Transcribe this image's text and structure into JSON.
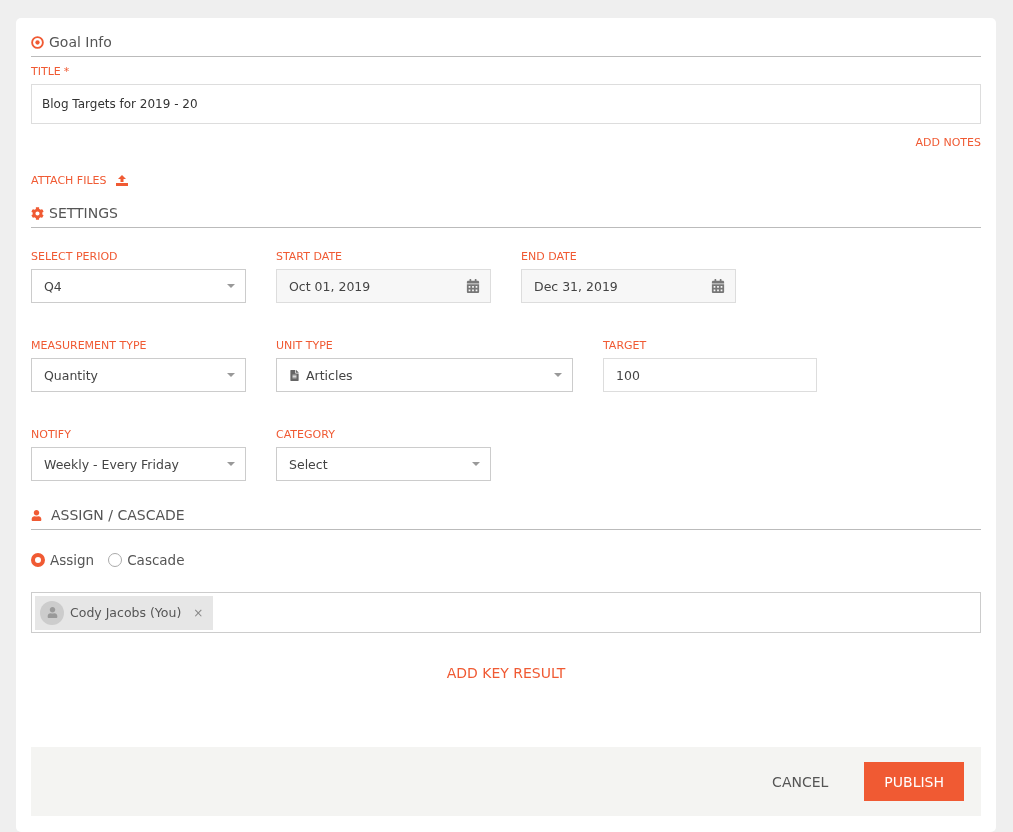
{
  "goal_info": {
    "heading": "Goal Info",
    "title_label": "TITLE",
    "required_mark": "*",
    "title_value": "Blog Targets for 2019 - 20",
    "add_notes": "ADD NOTES",
    "attach_files": "ATTACH FILES"
  },
  "settings": {
    "heading": "SETTINGS",
    "rows": [
      [
        {
          "kind": "select",
          "label": "SELECT PERIOD",
          "value": "Q4"
        },
        {
          "kind": "date",
          "label": "START DATE",
          "value": "Oct 01, 2019"
        },
        {
          "kind": "date",
          "label": "END DATE",
          "value": "Dec 31, 2019"
        }
      ],
      [
        {
          "kind": "select",
          "label": "MEASUREMENT TYPE",
          "value": "Quantity"
        },
        {
          "kind": "icon-select",
          "label": "UNIT TYPE",
          "value": "Articles"
        },
        {
          "kind": "text",
          "label": "TARGET",
          "value": "100"
        }
      ],
      [
        {
          "kind": "select",
          "label": "NOTIFY",
          "value": "Weekly - Every Friday"
        },
        {
          "kind": "select",
          "label": "CATEGORY",
          "value": "Select"
        }
      ]
    ]
  },
  "assign": {
    "heading": "ASSIGN / CASCADE",
    "options": [
      {
        "label": "Assign",
        "selected": true
      },
      {
        "label": "Cascade",
        "selected": false
      }
    ],
    "assignees": [
      {
        "name": "Cody Jacobs (You)",
        "remove": "×"
      }
    ],
    "add_key_result": "ADD KEY RESULT"
  },
  "footer": {
    "buttons": [
      {
        "kind": "secondary",
        "label": "CANCEL"
      },
      {
        "kind": "primary",
        "label": "PUBLISH"
      }
    ]
  }
}
